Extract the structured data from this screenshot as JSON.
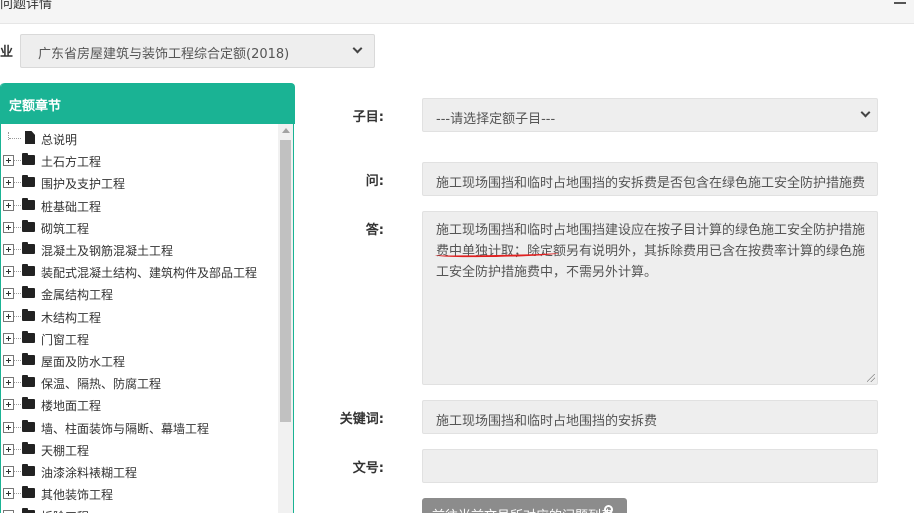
{
  "window": {
    "title": "问题详情"
  },
  "industry": {
    "label": "业",
    "selected": "广东省房屋建筑与装饰工程综合定额(2018)"
  },
  "chapter_panel": {
    "title": "定额章节",
    "items": [
      {
        "label": "总说明",
        "type": "file"
      },
      {
        "label": "土石方工程",
        "type": "folder"
      },
      {
        "label": "围护及支护工程",
        "type": "folder"
      },
      {
        "label": "桩基础工程",
        "type": "folder"
      },
      {
        "label": "砌筑工程",
        "type": "folder"
      },
      {
        "label": "混凝土及钢筋混凝土工程",
        "type": "folder"
      },
      {
        "label": "装配式混凝土结构、建筑构件及部品工程",
        "type": "folder"
      },
      {
        "label": "金属结构工程",
        "type": "folder"
      },
      {
        "label": "木结构工程",
        "type": "folder"
      },
      {
        "label": "门窗工程",
        "type": "folder"
      },
      {
        "label": "屋面及防水工程",
        "type": "folder"
      },
      {
        "label": "保温、隔热、防腐工程",
        "type": "folder"
      },
      {
        "label": "楼地面工程",
        "type": "folder"
      },
      {
        "label": "墙、柱面装饰与隔断、幕墙工程",
        "type": "folder"
      },
      {
        "label": "天棚工程",
        "type": "folder"
      },
      {
        "label": "油漆涂料裱糊工程",
        "type": "folder"
      },
      {
        "label": "其他装饰工程",
        "type": "folder"
      },
      {
        "label": "拆除工程",
        "type": "folder"
      }
    ]
  },
  "form": {
    "subitem_label": "子目:",
    "subitem_value": "---请选择定额子目---",
    "question_label": "问:",
    "question_value": "施工现场围挡和临时占地围挡的安拆费是否包含在绿色施工安全防护措施费中",
    "answer_label": "答:",
    "answer_value": "施工现场围挡和临时占地围挡建设应在按子目计算的绿色施工安全防护措施费中单独计取；除定额另有说明外，其拆除费用已含在按费率计算的绿色施工安全防护措施费中，不需另外计算。",
    "keyword_label": "关键词:",
    "keyword_value": "施工现场围挡和临时占地围挡的安拆费",
    "docno_label": "文号:",
    "docno_value": "",
    "goto_button": "前往当前文号所对应的问题列表"
  },
  "colors": {
    "accent": "#1ab394",
    "annotation": "#e02020"
  }
}
